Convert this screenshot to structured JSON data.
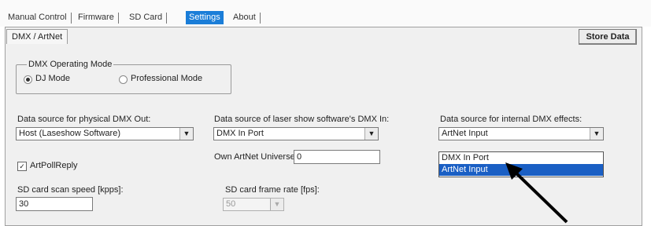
{
  "tabs": [
    {
      "label": "Manual Control",
      "active": false
    },
    {
      "label": "Firmware",
      "active": false
    },
    {
      "label": "SD Card",
      "active": false
    },
    {
      "label": "Settings",
      "active": true
    },
    {
      "label": "About",
      "active": false
    }
  ],
  "subtab": {
    "label": "DMX / ArtNet"
  },
  "store_button": {
    "label": "Store Data"
  },
  "dmx_mode": {
    "title": "DMX Operating Mode",
    "options": [
      {
        "label": "DJ Mode",
        "selected": true
      },
      {
        "label": "Professional Mode",
        "selected": false
      }
    ]
  },
  "physical_out": {
    "label": "Data source for physical DMX Out:",
    "value": "Host (Laseshow Software)"
  },
  "laser_in": {
    "label": "Data source of laser show software's DMX In:",
    "value": "DMX In Port"
  },
  "internal_effects": {
    "label": "Data source for internal DMX effects:",
    "value": "ArtNet Input",
    "options": [
      "DMX In Port",
      "ArtNet Input"
    ],
    "highlighted": "ArtNet Input"
  },
  "artnet_universe": {
    "label": "Own ArtNet Universe:",
    "value": "0"
  },
  "artpollreply": {
    "label": "ArtPollReply",
    "checked": true
  },
  "sd_scan": {
    "label": "SD card scan speed [kpps]:",
    "value": "30"
  },
  "sd_frame": {
    "label": "SD card frame rate [fps]:",
    "value": "50"
  },
  "colors": {
    "accent": "#1a7dd8",
    "highlight": "#1a5fc4"
  }
}
